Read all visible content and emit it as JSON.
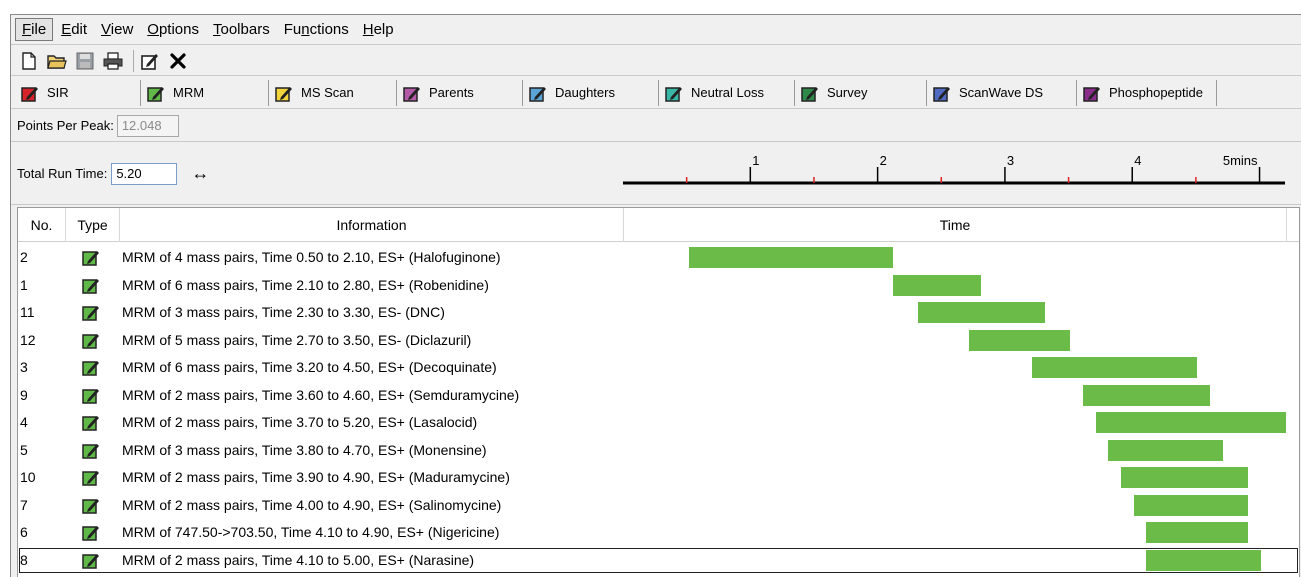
{
  "menu": [
    {
      "label": "File",
      "u": "F",
      "rest": "ile",
      "active": true
    },
    {
      "label": "Edit",
      "u": "E",
      "rest": "dit"
    },
    {
      "label": "View",
      "u": "V",
      "rest": "iew"
    },
    {
      "label": "Options",
      "u": "O",
      "rest": "ptions"
    },
    {
      "label": "Toolbars",
      "u": "T",
      "rest": "oolbars"
    },
    {
      "label": "Functions",
      "u": "n",
      "pre": "Fu",
      "rest": "ctions"
    },
    {
      "label": "Help",
      "u": "H",
      "rest": "elp"
    }
  ],
  "icons": [
    "new-file-icon",
    "open-folder-icon",
    "save-icon",
    "print-icon",
    "edit-icon",
    "close-icon"
  ],
  "functions": [
    {
      "label": "SIR",
      "color": "#d8232a",
      "name": "sir"
    },
    {
      "label": "MRM",
      "color": "#5fb847",
      "name": "mrm"
    },
    {
      "label": "MS Scan",
      "color": "#f2d53c",
      "name": "ms-scan"
    },
    {
      "label": "Parents",
      "color": "#b35aa8",
      "name": "parents"
    },
    {
      "label": "Daughters",
      "color": "#5aa5d6",
      "name": "daughters"
    },
    {
      "label": "Neutral Loss",
      "color": "#39b7a6",
      "name": "neutral-loss"
    },
    {
      "label": "Survey",
      "color": "#2f8a4a",
      "name": "survey"
    },
    {
      "label": "ScanWave DS",
      "color": "#4f6bc1",
      "name": "scanwave-ds"
    },
    {
      "label": "Phosphopeptide",
      "color": "#8a2d8a",
      "name": "phosphopeptide"
    }
  ],
  "points_per_peak": {
    "label": "Points Per Peak:",
    "value": "12.048"
  },
  "run_time": {
    "label": "Total Run Time:",
    "value": "5.20",
    "arrow": "↔"
  },
  "ruler": {
    "ticks": [
      "1",
      "2",
      "3",
      "4",
      "5mins"
    ],
    "min": 0,
    "max": 5.2
  },
  "table": {
    "headers": {
      "no": "No.",
      "type": "Type",
      "info": "Information",
      "time": "Time"
    },
    "rows": [
      {
        "no": "2",
        "info": "MRM of 4 mass pairs, Time 0.50 to 2.10, ES+ (Halofuginone)",
        "start": 0.5,
        "end": 2.1
      },
      {
        "no": "1",
        "info": "MRM of 6 mass pairs, Time 2.10 to 2.80, ES+ (Robenidine)",
        "start": 2.1,
        "end": 2.8
      },
      {
        "no": "11",
        "info": "MRM of 3 mass pairs, Time 2.30 to 3.30, ES- (DNC)",
        "start": 2.3,
        "end": 3.3
      },
      {
        "no": "12",
        "info": "MRM of 5 mass pairs, Time 2.70 to 3.50, ES- (Diclazuril)",
        "start": 2.7,
        "end": 3.5
      },
      {
        "no": "3",
        "info": "MRM of 6 mass pairs, Time 3.20 to 4.50, ES+ (Decoquinate)",
        "start": 3.2,
        "end": 4.5
      },
      {
        "no": "9",
        "info": "MRM of 2 mass pairs, Time 3.60 to 4.60, ES+ (Semduramycine)",
        "start": 3.6,
        "end": 4.6
      },
      {
        "no": "4",
        "info": "MRM of 2 mass pairs, Time 3.70 to 5.20, ES+ (Lasalocid)",
        "start": 3.7,
        "end": 5.2
      },
      {
        "no": "5",
        "info": "MRM of 3 mass pairs, Time 3.80 to 4.70, ES+ (Monensine)",
        "start": 3.8,
        "end": 4.7
      },
      {
        "no": "10",
        "info": "MRM of 2 mass pairs, Time 3.90 to 4.90, ES+ (Maduramycine)",
        "start": 3.9,
        "end": 4.9
      },
      {
        "no": "7",
        "info": "MRM of 2 mass pairs, Time 4.00 to 4.90, ES+ (Salinomycine)",
        "start": 4.0,
        "end": 4.9
      },
      {
        "no": "6",
        "info": "MRM of 747.50->703.50, Time 4.10 to 4.90, ES+ (Nigericine)",
        "start": 4.1,
        "end": 4.9
      },
      {
        "no": "8",
        "info": "MRM of 2 mass pairs, Time 4.10 to 5.00, ES+ (Narasine)",
        "start": 4.1,
        "end": 5.0,
        "selected": true
      }
    ]
  },
  "colors": {
    "bar": "#6abb47",
    "mrm_icon": "#5fb847"
  }
}
